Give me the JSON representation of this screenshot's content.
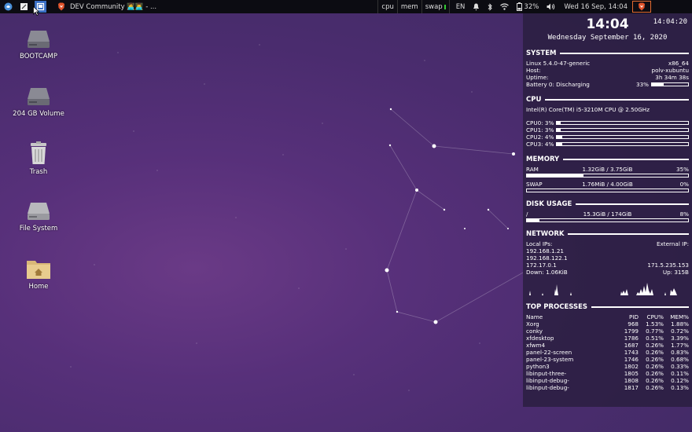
{
  "panel": {
    "task_title": "DEV Community 👩‍💻👨‍💻 - ...",
    "monitors": [
      "cpu",
      "mem",
      "swap"
    ],
    "keyboard_layout": "EN",
    "battery": "32%",
    "clock": "Wed 16 Sep, 14:04"
  },
  "desktop": {
    "icons": [
      {
        "label": "BOOTCAMP",
        "icon": "drive-icon"
      },
      {
        "label": "204 GB Volume",
        "icon": "drive-icon"
      },
      {
        "label": "Trash",
        "icon": "trash-icon"
      },
      {
        "label": "File System",
        "icon": "drive-icon"
      },
      {
        "label": "Home",
        "icon": "home-folder-icon"
      }
    ]
  },
  "conky": {
    "time_small": "14:04:20",
    "time_big": "14:04",
    "date": "Wednesday September 16, 2020",
    "system": {
      "title": "SYSTEM",
      "kernel": "Linux 5.4.0-47-generic",
      "arch": "x86_64",
      "host_label": "Host:",
      "host": "polv-xubuntu",
      "uptime_label": "Uptime:",
      "uptime": "3h 34m 38s",
      "battery_label": "Battery 0: Discharging",
      "battery": "33%",
      "battery_fraction": 0.33
    },
    "cpu": {
      "title": "CPU",
      "model": "Intel(R) Core(TM) i5-3210M CPU @ 2.50GHz",
      "cores": [
        {
          "label": "CPU0: 3%",
          "fraction": 0.03
        },
        {
          "label": "CPU1: 3%",
          "fraction": 0.03
        },
        {
          "label": "CPU2: 4%",
          "fraction": 0.04
        },
        {
          "label": "CPU3: 4%",
          "fraction": 0.04
        }
      ]
    },
    "memory": {
      "title": "MEMORY",
      "ram_label": "RAM",
      "ram_usage": "1.32GiB / 3.75GiB",
      "ram_pct": "35%",
      "ram_fraction": 0.35,
      "swap_label": "SWAP",
      "swap_usage": "1.76MiB / 4.00GiB",
      "swap_pct": "0%",
      "swap_fraction": 0.0
    },
    "disk": {
      "title": "DISK USAGE",
      "mount": "/",
      "usage": "15.3GiB / 174GiB",
      "pct": "8%",
      "fraction": 0.08
    },
    "network": {
      "title": "NETWORK",
      "local_label": "Local IPs:",
      "external_label": "External IP:",
      "ip1": "192.168.1.21",
      "ip2": "192.168.122.1",
      "ip3": "172.17.0.1",
      "external_ip": "171.5.235.153",
      "down": "Down: 1.06KiB",
      "up": "Up: 315B"
    },
    "processes": {
      "title": "TOP PROCESSES",
      "headers": {
        "name": "Name",
        "pid": "PID",
        "cpu": "CPU%",
        "mem": "MEM%"
      },
      "rows": [
        {
          "name": "Xorg",
          "pid": "968",
          "cpu": "1.53%",
          "mem": "1.88%"
        },
        {
          "name": "conky",
          "pid": "1799",
          "cpu": "0.77%",
          "mem": "0.72%"
        },
        {
          "name": "xfdesktop",
          "pid": "1786",
          "cpu": "0.51%",
          "mem": "3.39%"
        },
        {
          "name": "xfwm4",
          "pid": "1687",
          "cpu": "0.26%",
          "mem": "1.77%"
        },
        {
          "name": "panel-22-screen",
          "pid": "1743",
          "cpu": "0.26%",
          "mem": "0.83%"
        },
        {
          "name": "panel-23-system",
          "pid": "1746",
          "cpu": "0.26%",
          "mem": "0.68%"
        },
        {
          "name": "python3",
          "pid": "1802",
          "cpu": "0.26%",
          "mem": "0.33%"
        },
        {
          "name": "libinput-three-",
          "pid": "1805",
          "cpu": "0.26%",
          "mem": "0.11%"
        },
        {
          "name": "libinput-debug-",
          "pid": "1808",
          "cpu": "0.26%",
          "mem": "0.12%"
        },
        {
          "name": "libinput-debug-",
          "pid": "1817",
          "cpu": "0.26%",
          "mem": "0.13%"
        }
      ]
    }
  }
}
